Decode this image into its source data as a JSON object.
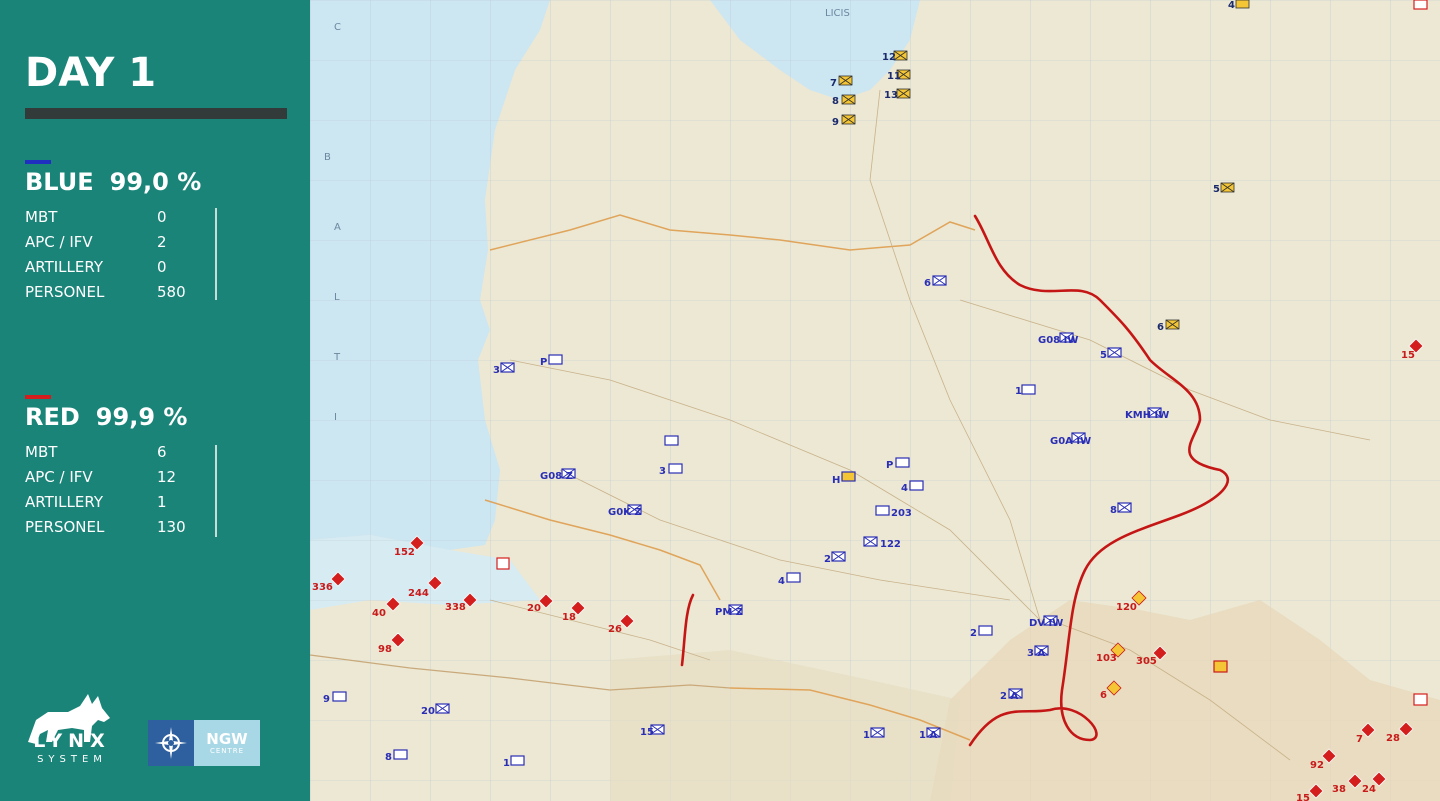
{
  "title": "DAY 1",
  "blue": {
    "name": "BLUE",
    "percent": "99,0 %",
    "color": "#1f2fbf",
    "stats": [
      {
        "label": "MBT",
        "value": "0"
      },
      {
        "label": "APC / IFV",
        "value": "2"
      },
      {
        "label": "ARTILLERY",
        "value": "0"
      },
      {
        "label": "PERSONEL",
        "value": "580"
      }
    ]
  },
  "red": {
    "name": "RED",
    "percent": "99,9 %",
    "color": "#d41e1e",
    "stats": [
      {
        "label": "MBT",
        "value": "6"
      },
      {
        "label": "APC / IFV",
        "value": "12"
      },
      {
        "label": "ARTILLERY",
        "value": "1"
      },
      {
        "label": "PERSONEL",
        "value": "130"
      }
    ]
  },
  "logos": {
    "lynx_title": "LYNX",
    "lynx_sub": "SYSTEM",
    "ngw_name": "NGW",
    "ngw_sub": "CENTRE"
  },
  "map": {
    "sea_labels": [
      "B",
      "A",
      "L",
      "T",
      "I",
      "C"
    ],
    "gulf_label": "LICIS",
    "yellow_units": [
      "12",
      "7",
      "11",
      "8",
      "13",
      "9",
      "4",
      "5",
      "6"
    ],
    "blue_units": [
      "G08 IW",
      "5",
      "6",
      "1",
      "KMH IW",
      "G0A IW",
      "P",
      "3",
      "P",
      "3",
      "G08 Z",
      "G0K Z",
      "H",
      "P",
      "4",
      "203",
      "122",
      "8",
      "2",
      "4",
      "PM Z",
      "2",
      "DV IW",
      "3 A",
      "2 A",
      "9",
      "20",
      "15",
      "1",
      "8",
      "1",
      "1 A"
    ],
    "red_units": [
      "152",
      "336",
      "244",
      "40",
      "338",
      "20",
      "18",
      "26",
      "98",
      "120",
      "103",
      "305",
      "6",
      "15",
      "7",
      "28",
      "92",
      "24",
      "38",
      "15"
    ],
    "colors": {
      "sea": "#cce6f2",
      "land": "#ece8d4",
      "front_line": "#c51616",
      "yellow_unit": "#f4c534",
      "blue_unit": "#2a2eb4",
      "red_unit": "#d41e1e",
      "panel": "#1a8479"
    }
  }
}
